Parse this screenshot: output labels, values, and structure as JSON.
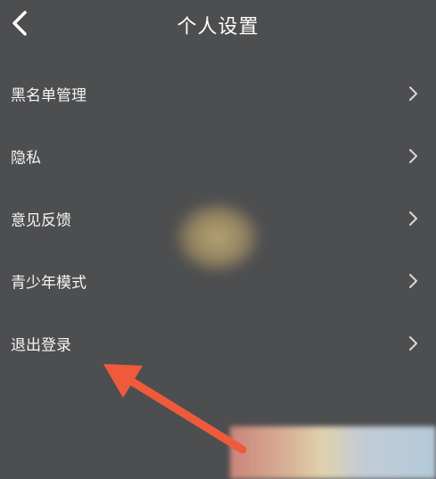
{
  "header": {
    "title": "个人设置",
    "back_icon": "chevron-left-icon"
  },
  "menu": {
    "items": [
      {
        "label": "黑名单管理",
        "icon": "chevron-right-icon"
      },
      {
        "label": "隐私",
        "icon": "chevron-right-icon"
      },
      {
        "label": "意见反馈",
        "icon": "chevron-right-icon"
      },
      {
        "label": "青少年模式",
        "icon": "chevron-right-icon"
      },
      {
        "label": "退出登录",
        "icon": "chevron-right-icon"
      }
    ]
  },
  "colors": {
    "background": "#4d4e50",
    "text": "#ffffff",
    "annotation_arrow": "#f05a3c"
  }
}
